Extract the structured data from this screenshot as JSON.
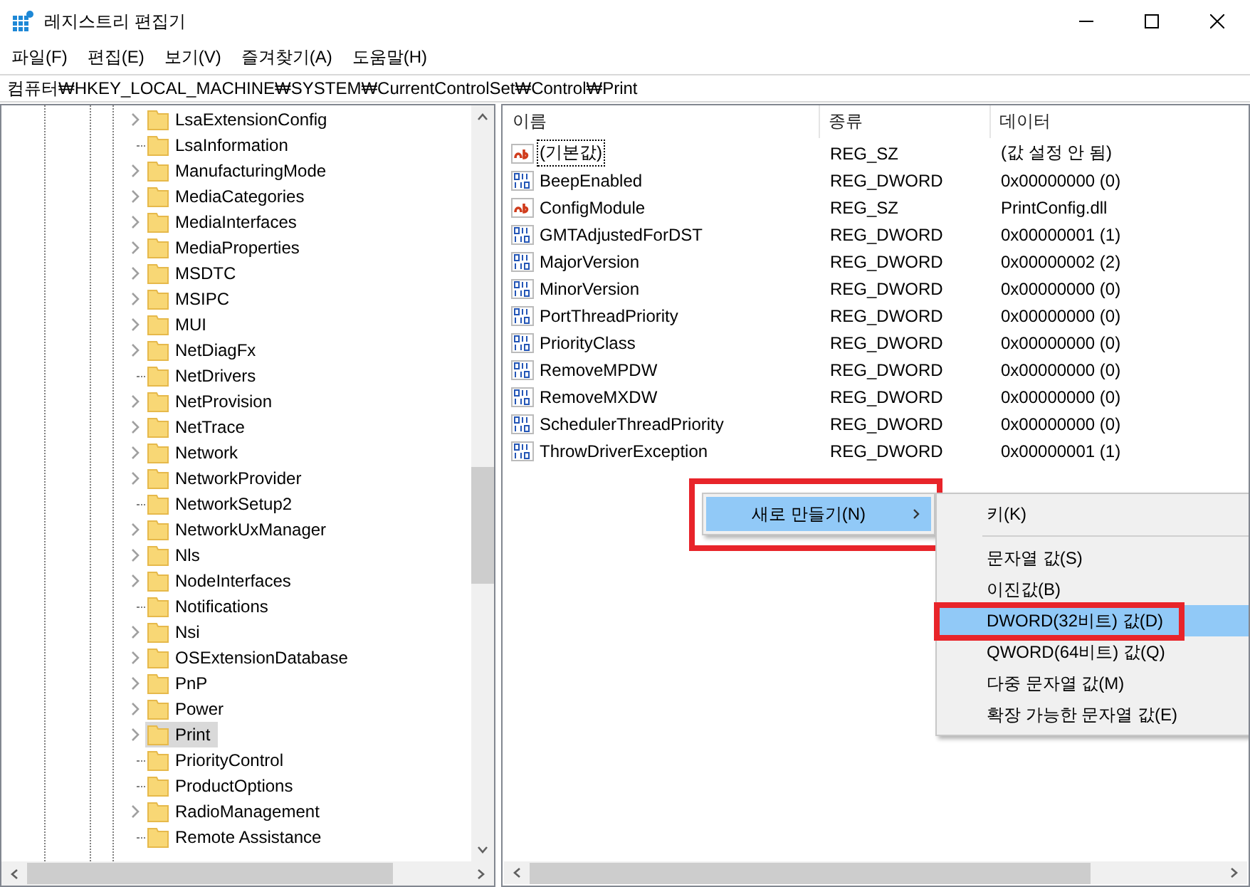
{
  "window": {
    "title": "레지스트리 편집기"
  },
  "menu_bar": [
    "파일(F)",
    "편집(E)",
    "보기(V)",
    "즐겨찾기(A)",
    "도움말(H)"
  ],
  "address": "컴퓨터₩HKEY_LOCAL_MACHINE₩SYSTEM₩CurrentControlSet₩Control₩Print",
  "tree": {
    "items": [
      {
        "label": "LsaExtensionConfig",
        "expandable": true,
        "selected": false
      },
      {
        "label": "LsaInformation",
        "expandable": false,
        "selected": false
      },
      {
        "label": "ManufacturingMode",
        "expandable": true,
        "selected": false
      },
      {
        "label": "MediaCategories",
        "expandable": true,
        "selected": false
      },
      {
        "label": "MediaInterfaces",
        "expandable": true,
        "selected": false
      },
      {
        "label": "MediaProperties",
        "expandable": true,
        "selected": false
      },
      {
        "label": "MSDTC",
        "expandable": true,
        "selected": false
      },
      {
        "label": "MSIPC",
        "expandable": true,
        "selected": false
      },
      {
        "label": "MUI",
        "expandable": true,
        "selected": false
      },
      {
        "label": "NetDiagFx",
        "expandable": true,
        "selected": false
      },
      {
        "label": "NetDrivers",
        "expandable": false,
        "selected": false
      },
      {
        "label": "NetProvision",
        "expandable": true,
        "selected": false
      },
      {
        "label": "NetTrace",
        "expandable": true,
        "selected": false
      },
      {
        "label": "Network",
        "expandable": true,
        "selected": false
      },
      {
        "label": "NetworkProvider",
        "expandable": true,
        "selected": false
      },
      {
        "label": "NetworkSetup2",
        "expandable": false,
        "selected": false
      },
      {
        "label": "NetworkUxManager",
        "expandable": true,
        "selected": false
      },
      {
        "label": "Nls",
        "expandable": true,
        "selected": false
      },
      {
        "label": "NodeInterfaces",
        "expandable": true,
        "selected": false
      },
      {
        "label": "Notifications",
        "expandable": false,
        "selected": false
      },
      {
        "label": "Nsi",
        "expandable": true,
        "selected": false
      },
      {
        "label": "OSExtensionDatabase",
        "expandable": true,
        "selected": false
      },
      {
        "label": "PnP",
        "expandable": true,
        "selected": false
      },
      {
        "label": "Power",
        "expandable": true,
        "selected": false
      },
      {
        "label": "Print",
        "expandable": true,
        "selected": true
      },
      {
        "label": "PriorityControl",
        "expandable": false,
        "selected": false
      },
      {
        "label": "ProductOptions",
        "expandable": false,
        "selected": false
      },
      {
        "label": "RadioManagement",
        "expandable": true,
        "selected": false
      },
      {
        "label": "Remote Assistance",
        "expandable": false,
        "selected": false
      }
    ]
  },
  "values": {
    "columns": [
      "이름",
      "종류",
      "데이터"
    ],
    "rows": [
      {
        "name": "(기본값)",
        "type": "REG_SZ",
        "data": "(값 설정 안 됨)",
        "kind": "string",
        "focused": true
      },
      {
        "name": "BeepEnabled",
        "type": "REG_DWORD",
        "data": "0x00000000 (0)",
        "kind": "binary",
        "focused": false
      },
      {
        "name": "ConfigModule",
        "type": "REG_SZ",
        "data": "PrintConfig.dll",
        "kind": "string",
        "focused": false
      },
      {
        "name": "GMTAdjustedForDST",
        "type": "REG_DWORD",
        "data": "0x00000001 (1)",
        "kind": "binary",
        "focused": false
      },
      {
        "name": "MajorVersion",
        "type": "REG_DWORD",
        "data": "0x00000002 (2)",
        "kind": "binary",
        "focused": false
      },
      {
        "name": "MinorVersion",
        "type": "REG_DWORD",
        "data": "0x00000000 (0)",
        "kind": "binary",
        "focused": false
      },
      {
        "name": "PortThreadPriority",
        "type": "REG_DWORD",
        "data": "0x00000000 (0)",
        "kind": "binary",
        "focused": false
      },
      {
        "name": "PriorityClass",
        "type": "REG_DWORD",
        "data": "0x00000000 (0)",
        "kind": "binary",
        "focused": false
      },
      {
        "name": "RemoveMPDW",
        "type": "REG_DWORD",
        "data": "0x00000000 (0)",
        "kind": "binary",
        "focused": false
      },
      {
        "name": "RemoveMXDW",
        "type": "REG_DWORD",
        "data": "0x00000000 (0)",
        "kind": "binary",
        "focused": false
      },
      {
        "name": "SchedulerThreadPriority",
        "type": "REG_DWORD",
        "data": "0x00000000 (0)",
        "kind": "binary",
        "focused": false
      },
      {
        "name": "ThrowDriverException",
        "type": "REG_DWORD",
        "data": "0x00000001 (1)",
        "kind": "binary",
        "focused": false
      }
    ]
  },
  "context_menu": {
    "items": [
      {
        "label": "새로 만들기(N)",
        "has_submenu": true,
        "selected": true,
        "annotated": true
      }
    ]
  },
  "submenu": {
    "items": [
      {
        "kind": "item",
        "label": "키(K)",
        "selected": false,
        "annotated": false
      },
      {
        "kind": "separator"
      },
      {
        "kind": "item",
        "label": "문자열 값(S)",
        "selected": false,
        "annotated": false
      },
      {
        "kind": "item",
        "label": "이진값(B)",
        "selected": false,
        "annotated": false
      },
      {
        "kind": "item",
        "label": "DWORD(32비트) 값(D)",
        "selected": true,
        "annotated": true
      },
      {
        "kind": "item",
        "label": "QWORD(64비트) 값(Q)",
        "selected": false,
        "annotated": false
      },
      {
        "kind": "item",
        "label": "다중 문자열 값(M)",
        "selected": false,
        "annotated": false
      },
      {
        "kind": "item",
        "label": "확장 가능한 문자열 값(E)",
        "selected": false,
        "annotated": false
      }
    ]
  }
}
